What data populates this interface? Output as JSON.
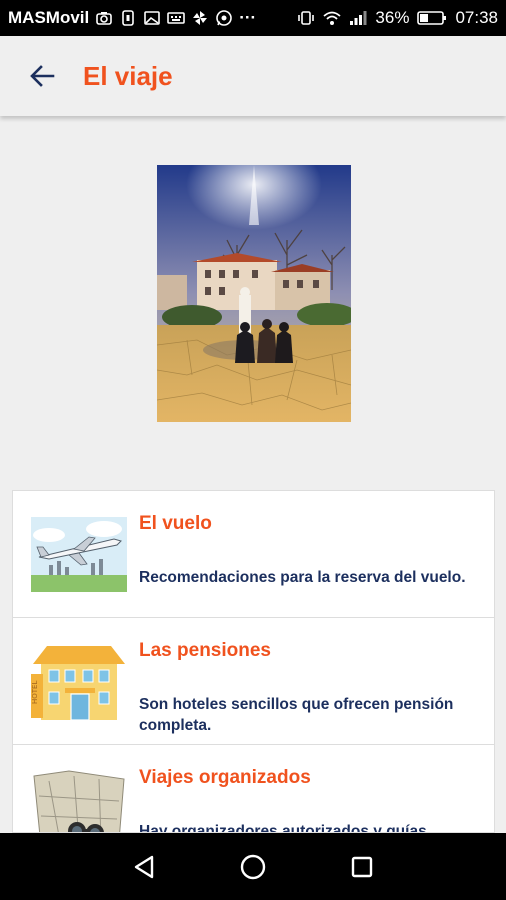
{
  "status_bar": {
    "carrier": "MASMovil",
    "battery": "36%",
    "time": "07:38",
    "more": "···"
  },
  "app_bar": {
    "title": "El viaje",
    "accent_color": "#f0521e"
  },
  "cards": [
    {
      "title": "El vuelo",
      "description": "Recomendaciones para la reserva del vuelo.",
      "icon": "airplane-icon"
    },
    {
      "title": "Las pensiones",
      "description": "Son hoteles sencillos que ofrecen pensión completa.",
      "icon": "hotel-icon"
    },
    {
      "title": "Viajes organizados",
      "description": "Hay organizadores autorizados y guías",
      "icon": "map-icon"
    }
  ],
  "colors": {
    "title": "#f0521e",
    "body_text": "#1c2f5e",
    "background": "#efefef"
  }
}
